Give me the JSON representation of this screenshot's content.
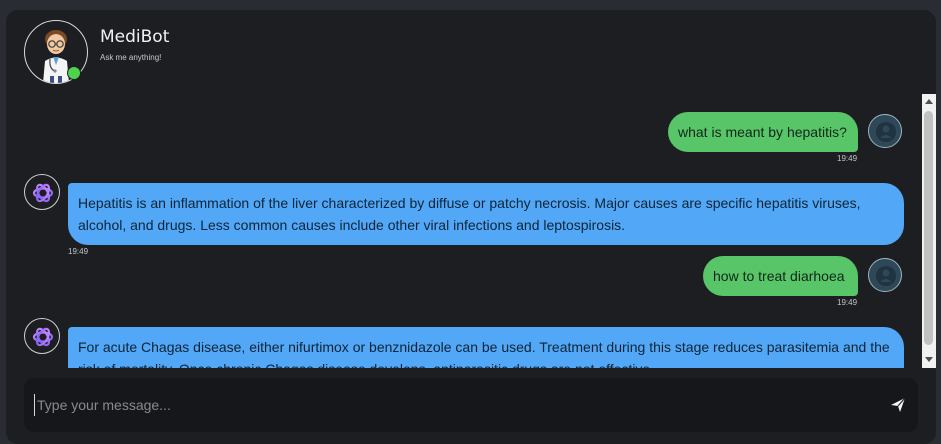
{
  "header": {
    "title": "MediBot",
    "subtitle": "Ask me anything!"
  },
  "messages": [
    {
      "sender": "user",
      "text": "what is meant by hepatitis?",
      "time": "19:49"
    },
    {
      "sender": "bot",
      "text": "Hepatitis is an inflammation of the liver characterized by diffuse or patchy necrosis. Major causes are specific hepatitis viruses, alcohol, and drugs. Less common causes include other viral infections and leptospirosis.",
      "time": "19:49"
    },
    {
      "sender": "user",
      "text": "how to treat diarhoea",
      "time": "19:49"
    },
    {
      "sender": "bot",
      "text": "For acute Chagas disease, either nifurtimox or benznidazole can be used. Treatment during this stage reduces parasitemia and the risk of mortality. Once chronic Chagas disease develops, antiparasitic drugs are not effective.",
      "time": ""
    }
  ],
  "input": {
    "placeholder": "Type your message...",
    "value": ""
  },
  "icons": {
    "bot_avatar": "doctor-avatar-icon",
    "online": "online-status-icon",
    "user_avatar": "user-avatar-icon",
    "bot_message": "openai-logo-icon",
    "send": "send-icon"
  },
  "colors": {
    "user_bubble": "#58c668",
    "bot_bubble": "#52a8f6",
    "background": "#1c1e22",
    "online": "#4cd44c"
  }
}
